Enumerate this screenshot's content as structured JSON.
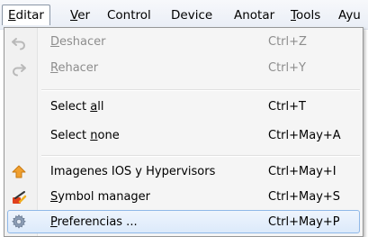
{
  "menubar": {
    "items": [
      {
        "pre": "",
        "key": "E",
        "post": "ditar"
      },
      {
        "pre": "",
        "key": "V",
        "post": "er"
      },
      {
        "pre": "",
        "key": "",
        "post": "Control"
      },
      {
        "pre": "",
        "key": "",
        "post": "Device"
      },
      {
        "pre": "",
        "key": "",
        "post": "Anotar"
      },
      {
        "pre": "",
        "key": "T",
        "post": "ools"
      },
      {
        "pre": "Ayu",
        "key": "",
        "post": ""
      }
    ]
  },
  "menu": {
    "items": [
      {
        "pre": "",
        "key": "D",
        "post": "eshacer",
        "shortcut": "Ctrl+Z",
        "icon": "undo-icon",
        "enabled": false
      },
      {
        "pre": "",
        "key": "R",
        "post": "ehacer",
        "shortcut": "Ctrl+Y",
        "icon": "redo-icon",
        "enabled": false
      },
      {
        "pre": "Select ",
        "key": "a",
        "post": "ll",
        "shortcut": "Ctrl+T",
        "icon": "",
        "enabled": true
      },
      {
        "pre": "Select ",
        "key": "n",
        "post": "one",
        "shortcut": "Ctrl+May+A",
        "icon": "",
        "enabled": true
      },
      {
        "pre": "Imagenes IOS y Hypervisors",
        "key": "",
        "post": "",
        "shortcut": "Ctrl+May+I",
        "icon": "up-arrow-icon",
        "enabled": true
      },
      {
        "pre": "",
        "key": "S",
        "post": "ymbol manager",
        "shortcut": "Ctrl+May+S",
        "icon": "symbol-manager-icon",
        "enabled": true
      },
      {
        "pre": "",
        "key": "P",
        "post": "referencias ...",
        "shortcut": "Ctrl+May+P",
        "icon": "gear-icon",
        "enabled": true
      }
    ]
  },
  "colors": {
    "hover_border": "#8fb8e8",
    "disabled_text": "#8d8d8d",
    "arrow_orange": "#f0a030"
  }
}
